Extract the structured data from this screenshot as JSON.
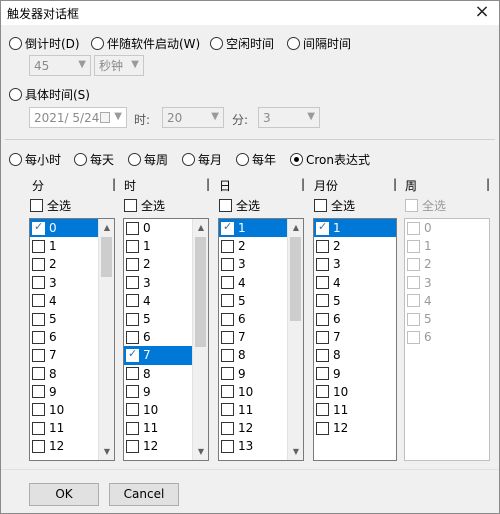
{
  "window": {
    "title": "触发器对话框",
    "close_glyph": "×"
  },
  "trigger_type": {
    "countdown": "倒计时(D)",
    "follow_software": "伴随软件启动(W)",
    "idle_time": "空闲时间",
    "interval_time": "间隔时间",
    "specific_time": "具体时间(S)"
  },
  "countdown_settings": {
    "value": "45",
    "unit": "秒钟"
  },
  "specific_settings": {
    "date": "2021/ 5/24",
    "hour_label": "时:",
    "hour_value": "20",
    "minute_label": "分:",
    "minute_value": "3"
  },
  "periodicity": {
    "hourly": "每小时",
    "daily": "每天",
    "weekly": "每周",
    "monthly": "每月",
    "yearly": "每年",
    "cron": "Cron表达式"
  },
  "columns": {
    "minute": "分",
    "hour": "时",
    "day": "日",
    "month": "月份",
    "week": "周",
    "separator": "|"
  },
  "select_all_label": "全选",
  "lists": {
    "minute": [
      "0",
      "1",
      "2",
      "3",
      "4",
      "5",
      "6",
      "7",
      "8",
      "9",
      "10",
      "11",
      "12"
    ],
    "hour": [
      "0",
      "1",
      "2",
      "3",
      "4",
      "5",
      "6",
      "7",
      "8",
      "9",
      "10",
      "11",
      "12"
    ],
    "day": [
      "1",
      "2",
      "3",
      "4",
      "5",
      "6",
      "7",
      "8",
      "9",
      "10",
      "11",
      "12",
      "13"
    ],
    "month": [
      "1",
      "2",
      "3",
      "4",
      "5",
      "6",
      "7",
      "8",
      "9",
      "10",
      "11",
      "12"
    ],
    "week": [
      "0",
      "1",
      "2",
      "3",
      "4",
      "5",
      "6"
    ]
  },
  "buttons": {
    "ok": "OK",
    "cancel": "Cancel"
  },
  "colors": {
    "selection": "#0078d7",
    "dialog_bg": "#f0f0f0"
  }
}
